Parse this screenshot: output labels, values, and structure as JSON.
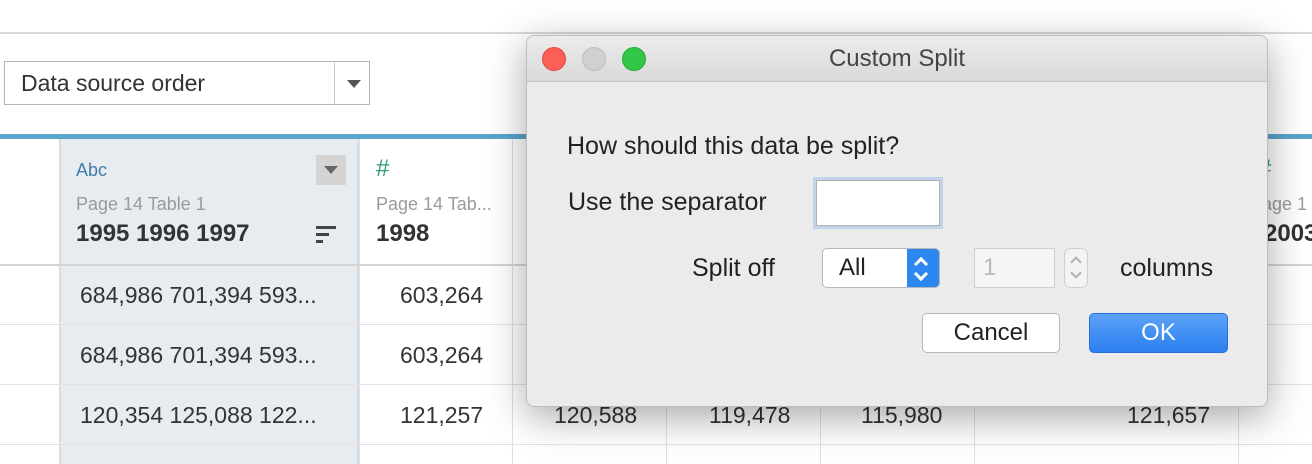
{
  "sort_dropdown": {
    "value": "Data source order"
  },
  "columns": [
    {
      "type_icon": "Abc",
      "source": "Page   14 Table  1",
      "name": "1995 1996 1997"
    },
    {
      "type_icon": "#",
      "source": "Page   14 Tab...",
      "name": "1998"
    },
    {
      "type_icon": "#",
      "source": "age  1",
      "name": "2003"
    }
  ],
  "rows": [
    {
      "c1": "684,986 701,394 593...",
      "c2": "603,264"
    },
    {
      "c1": "684,986 701,394 593...",
      "c2": "603,264"
    },
    {
      "c1": "120,354 125,088 122...",
      "c2": "121,257",
      "c3": "120,588",
      "c4": "119,478",
      "c5": "115,980",
      "c6": "121,657"
    }
  ],
  "dialog": {
    "title": "Custom Split",
    "question": "How should this data be split?",
    "separator_label": "Use the separator",
    "separator_value": "",
    "split_off_label": "Split off",
    "split_off_value": "All",
    "count_value": "1",
    "columns_label": "columns",
    "cancel_label": "Cancel",
    "ok_label": "OK"
  },
  "colors": {
    "header_accent": "#5aa5cd",
    "selected_column_bg": "#e7ecf1",
    "ok_button": "#2a7ff0",
    "close_dot": "#fc5f57",
    "zoom_dot": "#33c748"
  }
}
